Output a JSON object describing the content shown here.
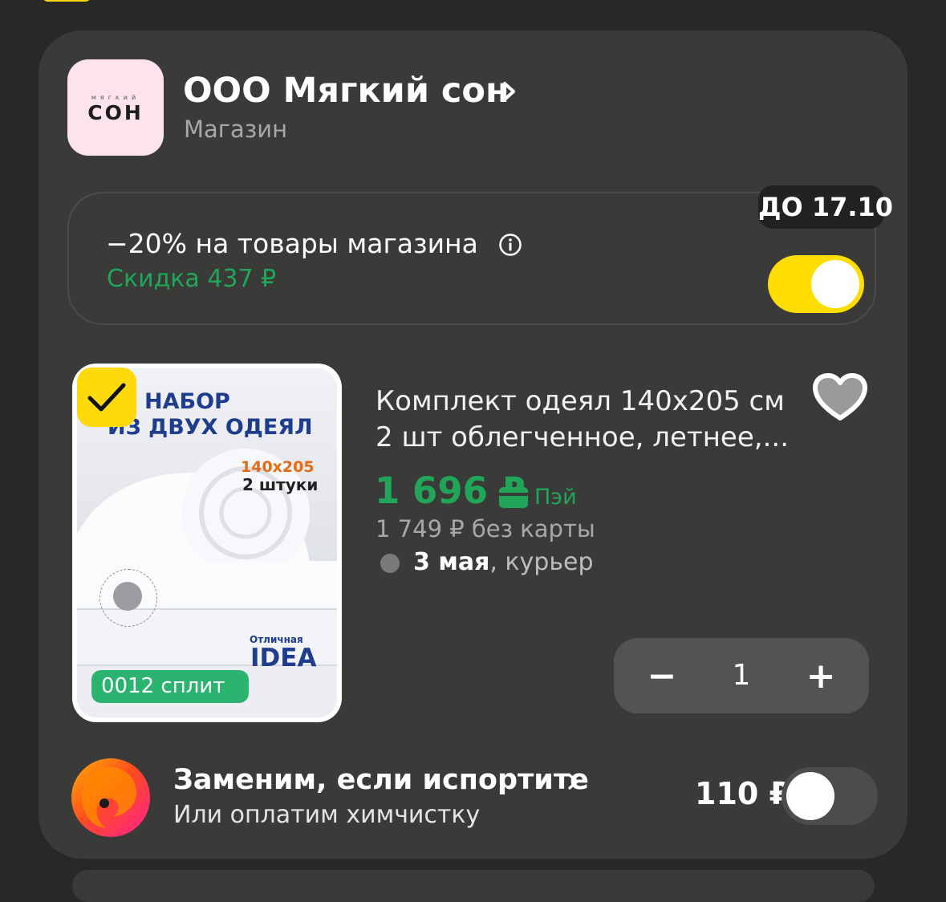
{
  "shop": {
    "logo_small": "мягкий",
    "logo_main": "СОН",
    "name": "ООО Мягкий сон",
    "type": "Магазин"
  },
  "promo": {
    "title": "−20% на товары магазина",
    "discount": "Скидка 437 ₽",
    "deadline": "ДО 17.10",
    "enabled": true
  },
  "product": {
    "image_text": {
      "line1": "НАБОР",
      "line2": "ИЗ ДВУХ ОДЕЯЛ",
      "size": "140х205",
      "count": "2 штуки",
      "brand_small": "Отличная",
      "brand_big": "IDEA"
    },
    "split_badge": "0012 сплит",
    "selected": true,
    "title": "Комплект одеял 140х205 см 2 шт облегченное, летнее,...",
    "price": "1 696 ₽",
    "pay_label": "Пэй",
    "old_price": "1 749 ₽ без карты",
    "delivery_date": "3 мая",
    "delivery_method": ", курьер",
    "quantity": "1",
    "minus": "−",
    "plus": "+"
  },
  "insurance": {
    "title": "Заменим, если испортите",
    "subtitle": "Или оплатим химчистку",
    "price": "110 ₽",
    "enabled": false
  },
  "colors": {
    "background": "#292826",
    "card": "#3a3a39",
    "accent_yellow": "#fedd00",
    "accent_green": "#20a659"
  },
  "icons": [
    "chevron-right-icon",
    "info-icon",
    "check-icon",
    "heart-icon",
    "card-icon",
    "swirl-logo-icon"
  ]
}
